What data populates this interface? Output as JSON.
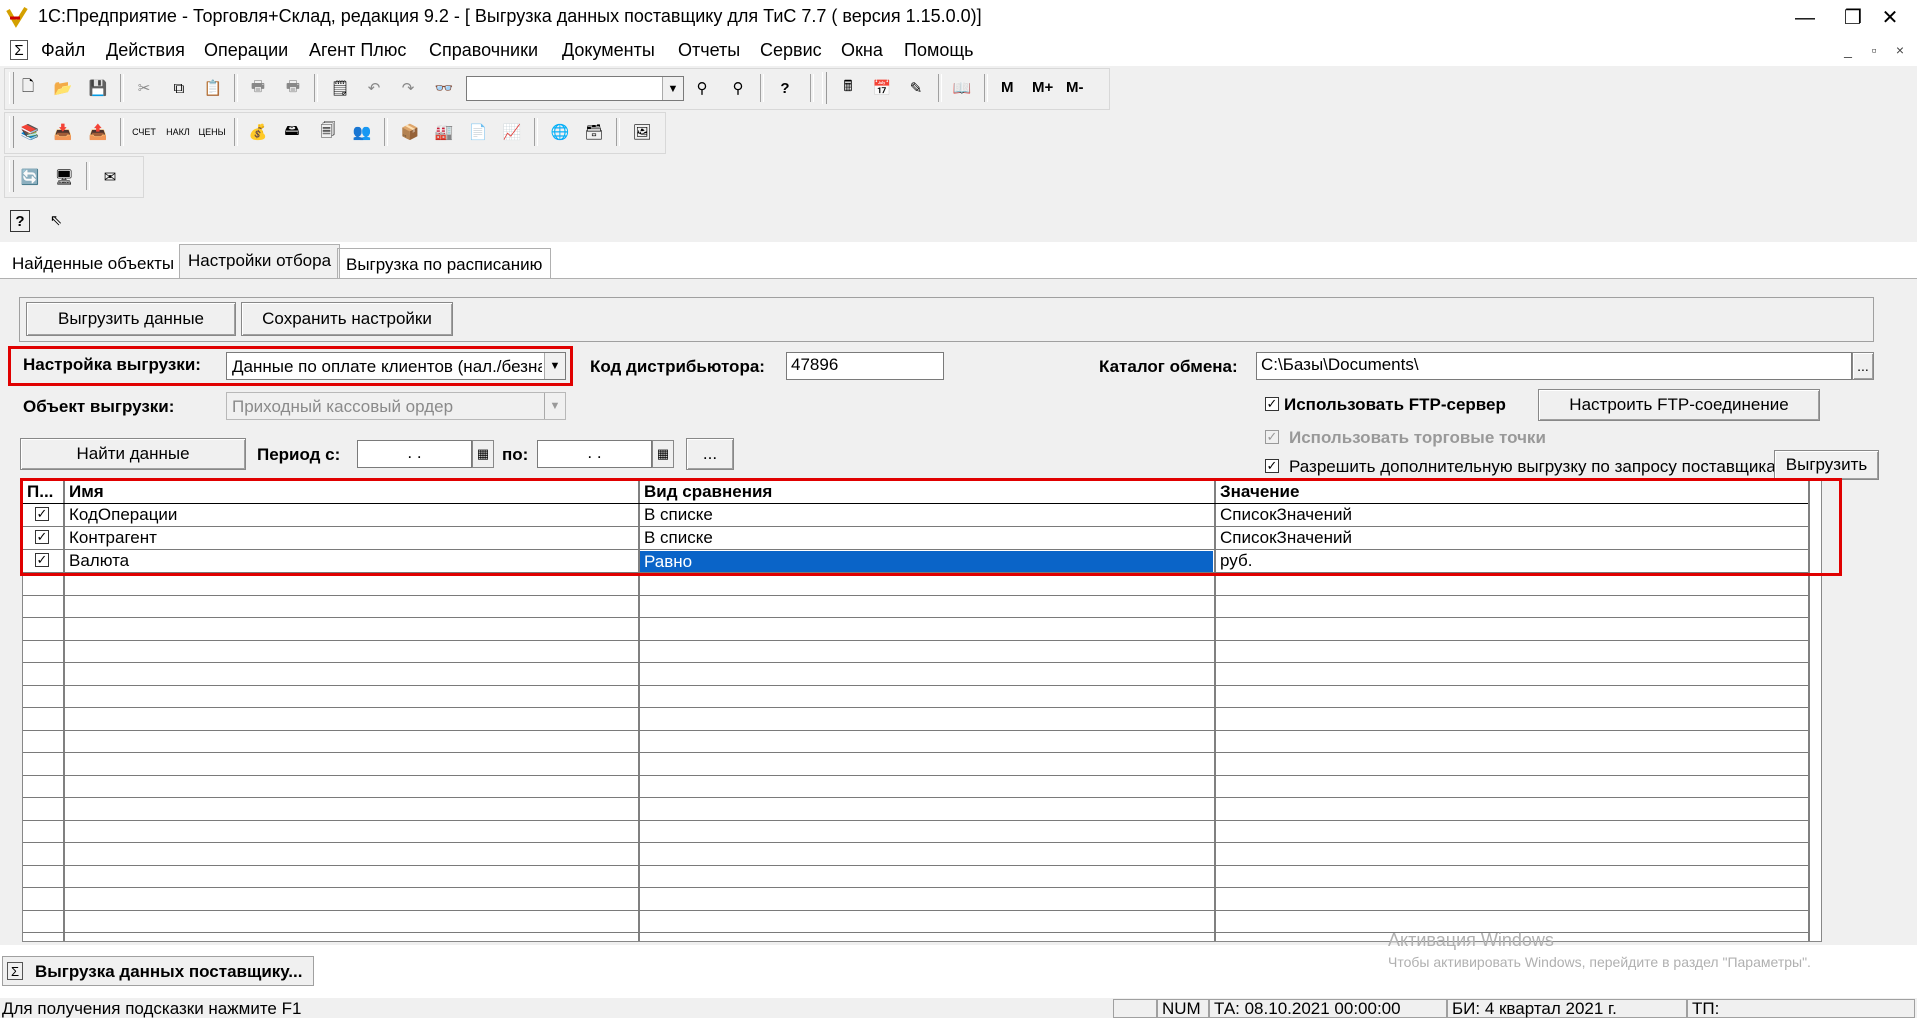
{
  "window": {
    "title": "1С:Предприятие - Торговля+Склад, редакция 9.2 - [ Выгрузка данных поставщику для ТиС 7.7 ( версия 1.15.0.0)]",
    "minimize_glyph": "—",
    "restore_glyph": "❐",
    "close_glyph": "✕"
  },
  "menu": {
    "icon": "Σ",
    "items": [
      "Файл",
      "Действия",
      "Операции",
      "Агент Плюс",
      "Справочники",
      "Документы",
      "Отчеты",
      "Сервис",
      "Окна",
      "Помощь"
    ],
    "mdi": [
      "_",
      "▫",
      "×"
    ]
  },
  "toolbar": {
    "search_value": "",
    "memory": [
      "M",
      "M+",
      "M-"
    ],
    "help_glyph": "?"
  },
  "tabs": [
    "Найденные объекты",
    "Настройки отбора",
    "Выгрузка по расписанию"
  ],
  "buttons": {
    "export": "Выгрузить данные",
    "save_settings": "Сохранить настройки",
    "find": "Найти данные",
    "ftp_setup": "Настроить FTP-соединение",
    "export_small": "Выгрузить",
    "period_more": "...",
    "catalog_more": "..."
  },
  "form": {
    "export_setting_label": "Настройка выгрузки:",
    "export_setting_value": "Данные по оплате клиентов (нал./безна",
    "distributor_label": "Код дистрибьютора:",
    "distributor_value": "47896",
    "catalog_label": "Каталог обмена:",
    "catalog_value": "C:\\Базы\\Documents\\",
    "object_label": "Объект выгрузки:",
    "object_value": "Приходный кассовый ордер",
    "period_from_label": "Период с:",
    "period_from_value": ". .",
    "period_to_label": "по:",
    "period_to_value": ". .",
    "use_ftp_label": "Использовать FTP-сервер",
    "use_ftp_checked": true,
    "use_points_label": "Использовать торговые точки",
    "use_points_checked": true,
    "allow_extra_label": "Разрешить дополнительную выгрузку по запросу поставщика",
    "allow_extra_checked": true
  },
  "grid": {
    "columns": [
      "П...",
      "Имя",
      "Вид сравнения",
      "Значение"
    ],
    "rows": [
      {
        "check": "✓",
        "name": "КодОперации",
        "compare": "В списке",
        "value": "СписокЗначений"
      },
      {
        "check": "✓",
        "name": "Контрагент",
        "compare": "В списке",
        "value": "СписокЗначений"
      },
      {
        "check": "✓",
        "name": "Валюта",
        "compare": "Равно",
        "value": "руб."
      }
    ],
    "scroll_up": "⌃"
  },
  "taskbar": {
    "window_button": "Выгрузка данных поставщику..."
  },
  "watermark": {
    "line1": "Активация Windows",
    "line2": "Чтобы активировать Windows, перейдите в раздел \"Параметры\"."
  },
  "status": {
    "hint": "Для получения подсказки нажмите F1",
    "num": "NUM",
    "ta": "ТА: 08.10.2021  00:00:00",
    "bi": "БИ: 4 квартал 2021 г.",
    "tp": "ТП:"
  }
}
